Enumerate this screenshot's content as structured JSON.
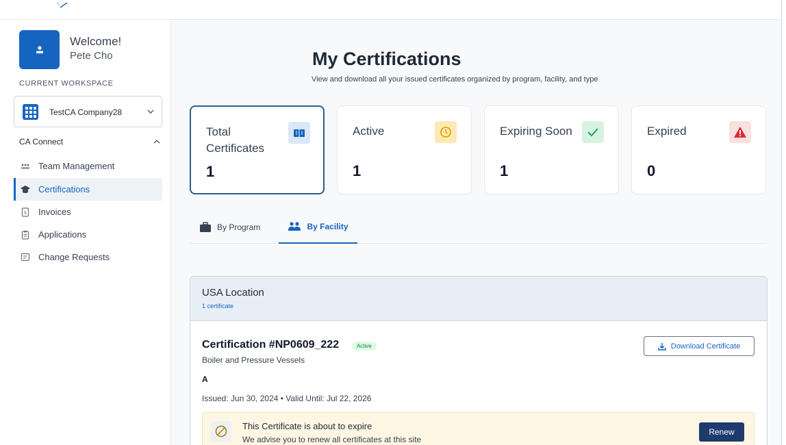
{
  "sidebar": {
    "welcome": "Welcome!",
    "user_name": "Pete Cho",
    "workspace_label": "CURRENT WORKSPACE",
    "workspace_name": "TestCA Company28",
    "section": "CA Connect",
    "items": [
      {
        "label": "Team Management",
        "icon": "team-icon"
      },
      {
        "label": "Certifications",
        "icon": "graduation-cap-icon",
        "active": true
      },
      {
        "label": "Invoices",
        "icon": "invoice-icon"
      },
      {
        "label": "Applications",
        "icon": "clipboard-icon"
      },
      {
        "label": "Change Requests",
        "icon": "change-request-icon"
      }
    ]
  },
  "header": {
    "title": "My Certifications",
    "subtitle": "View and download all your issued certificates organized by program, facility, and type"
  },
  "stats": [
    {
      "label": "Total Certificates",
      "value": "1",
      "icon": "book-icon",
      "color": "#1565c0",
      "bg": "#dbe7f6"
    },
    {
      "label": "Active",
      "value": "1",
      "icon": "clock-icon",
      "color": "#e6a200",
      "bg": "#fde9b4"
    },
    {
      "label": "Expiring Soon",
      "value": "1",
      "icon": "check-icon",
      "color": "#22a45a",
      "bg": "#d6f3e1"
    },
    {
      "label": "Expired",
      "value": "0",
      "icon": "warning-icon",
      "color": "#d32f2f",
      "bg": "#fbe0e0"
    }
  ],
  "tabs": [
    {
      "label": "By Program",
      "icon": "briefcase-icon"
    },
    {
      "label": "By Facility",
      "icon": "users-icon",
      "active": true
    }
  ],
  "facility": {
    "name": "USA Location",
    "count": "1 certificate",
    "certificate": {
      "title": "Certification #NP0609_222",
      "status": "Active",
      "type": "Boiler and Pressure Vessels",
      "grade": "A",
      "dates": "Issued: Jun 30, 2024 • Valid Until: Jul 22, 2026",
      "download_label": "Download Certificate"
    },
    "warning": {
      "title": "This Certificate is about to expire",
      "text": "We advise you to renew all certificates at this site",
      "renew_label": "Renew"
    }
  }
}
